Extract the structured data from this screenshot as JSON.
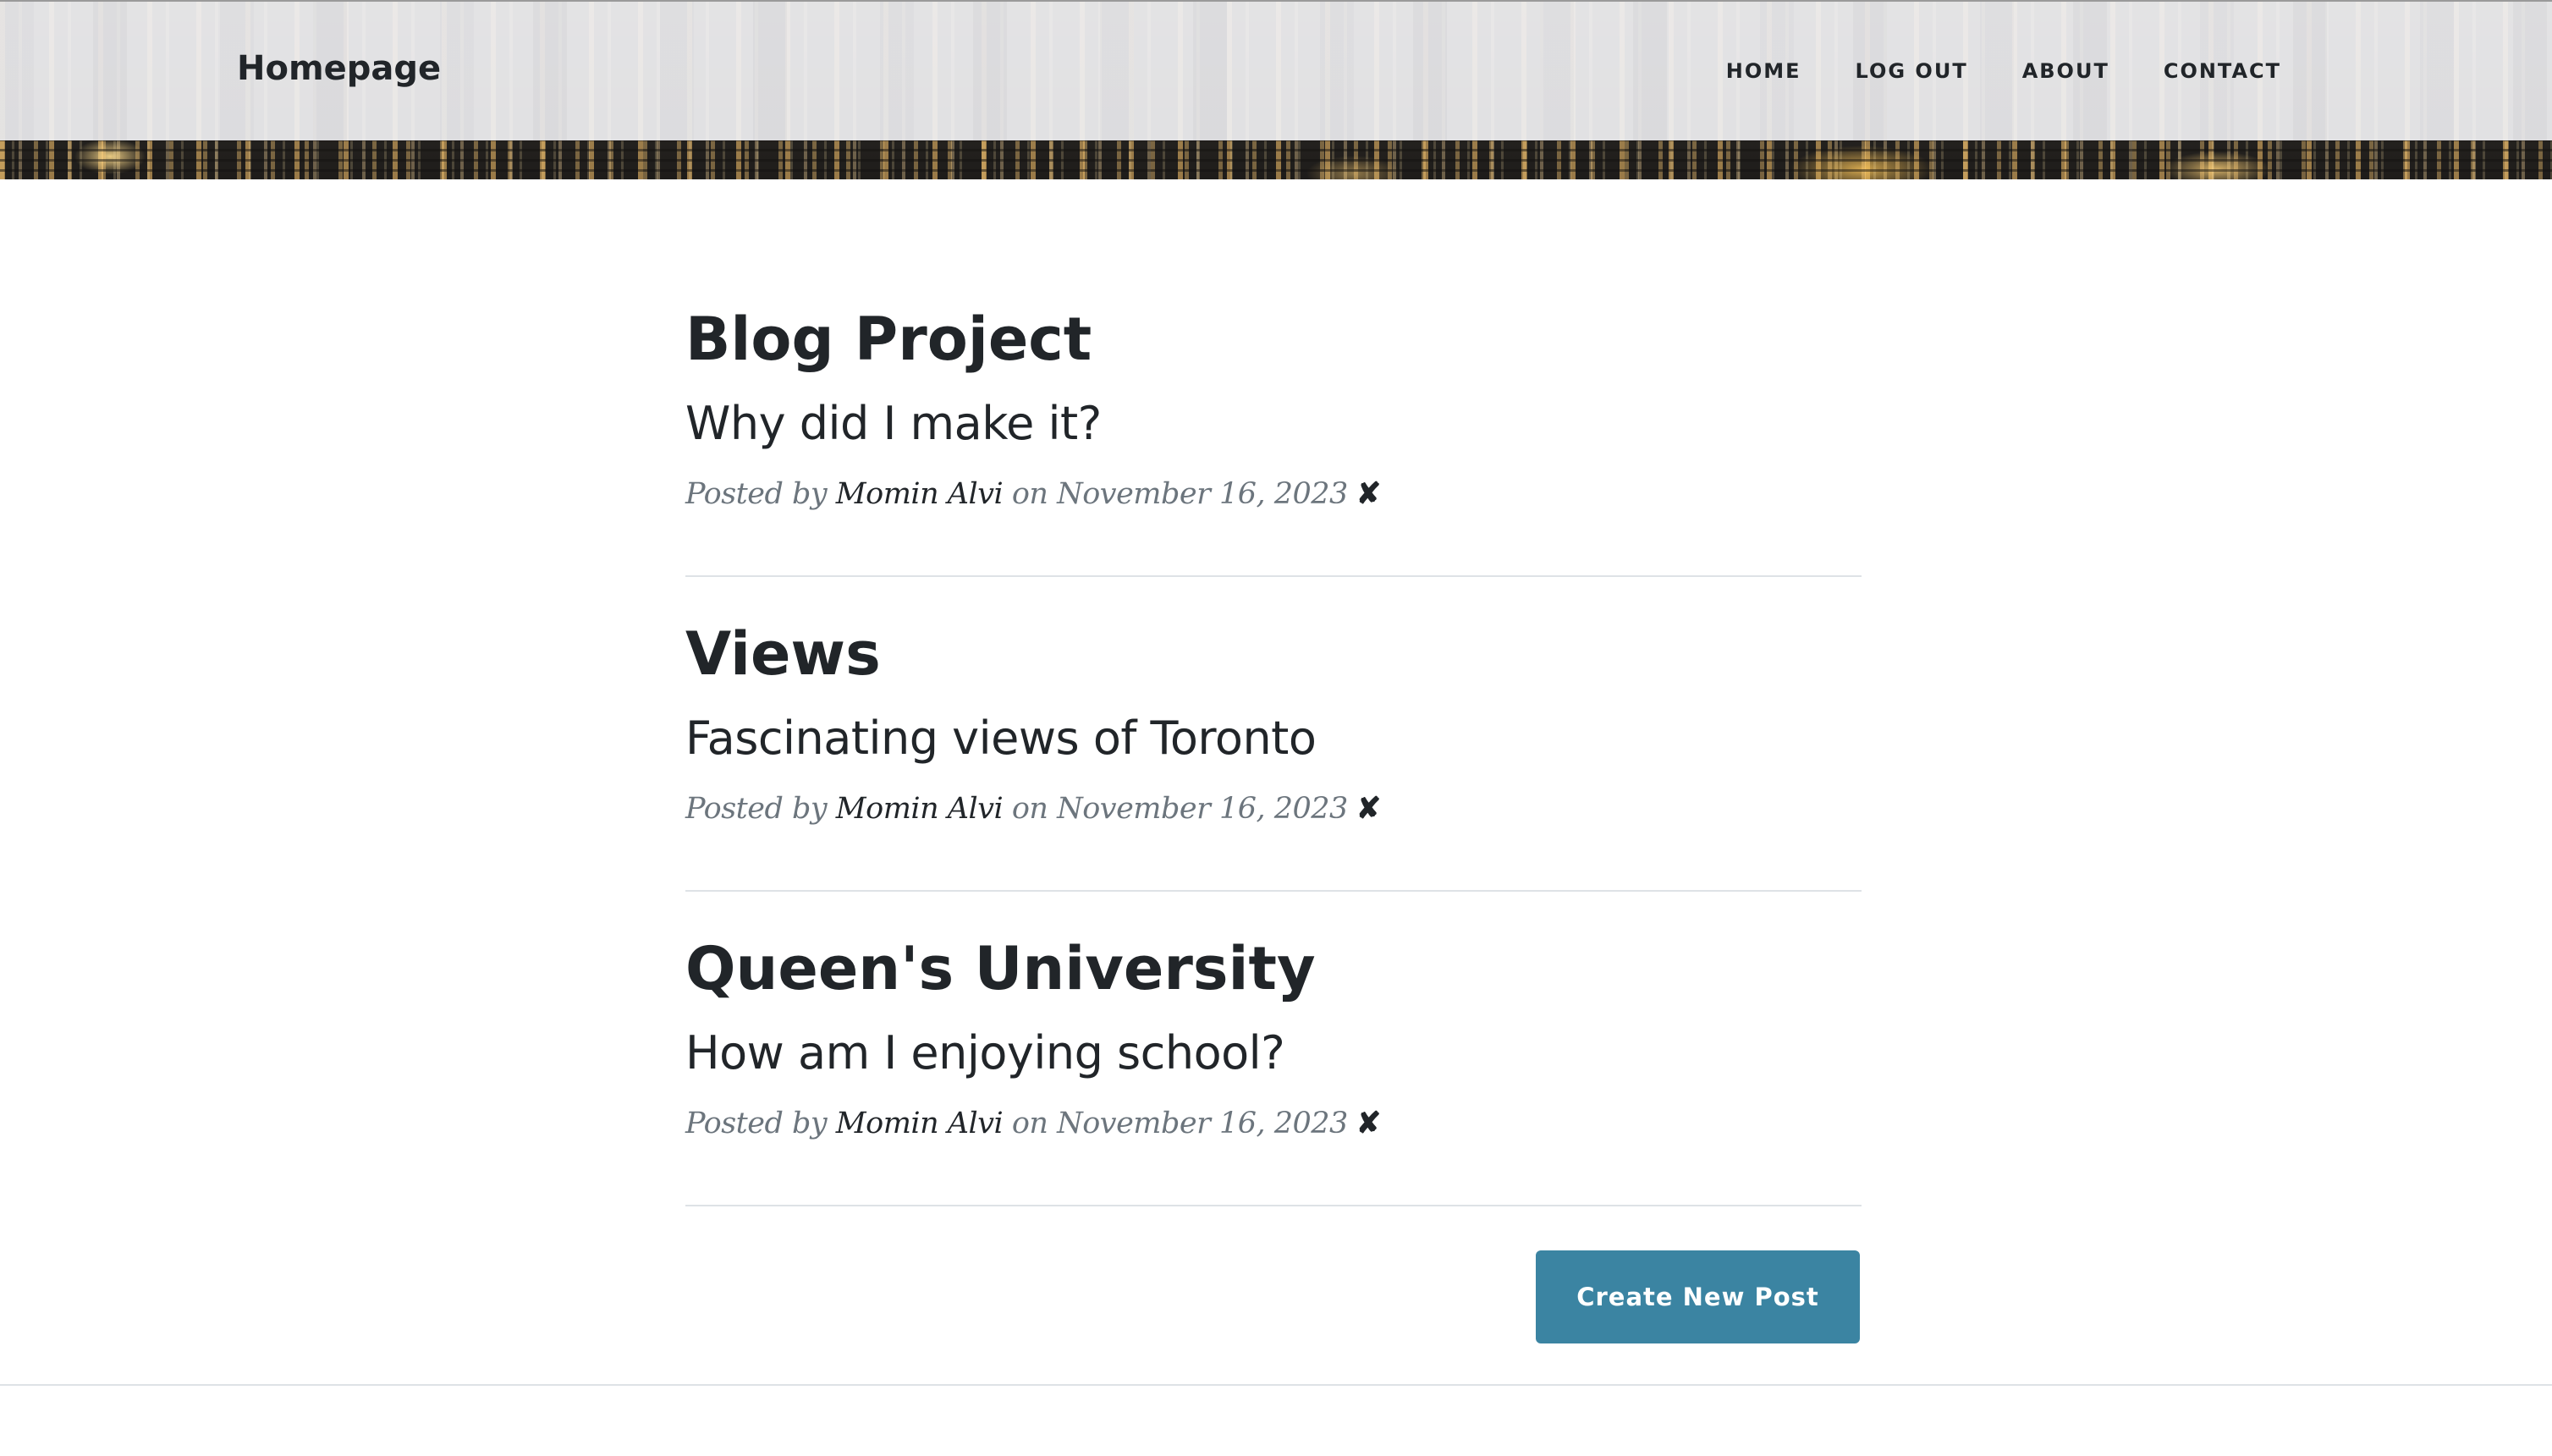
{
  "header": {
    "brand": "Homepage",
    "nav": {
      "home": "HOME",
      "logout": "LOG OUT",
      "about": "ABOUT",
      "contact": "CONTACT"
    }
  },
  "posts": [
    {
      "title": "Blog Project",
      "subtitle": "Why did I make it?",
      "posted_by": "Posted by",
      "author": "Momin Alvi",
      "on": "on",
      "date": "November 16, 2023",
      "delete_icon": "✘"
    },
    {
      "title": "Views",
      "subtitle": "Fascinating views of Toronto",
      "posted_by": "Posted by",
      "author": "Momin Alvi",
      "on": "on",
      "date": "November 16, 2023",
      "delete_icon": "✘"
    },
    {
      "title": "Queen's University",
      "subtitle": "How am I enjoying school?",
      "posted_by": "Posted by",
      "author": "Momin Alvi",
      "on": "on",
      "date": "November 16, 2023",
      "delete_icon": "✘"
    }
  ],
  "actions": {
    "create_label": "Create New Post"
  },
  "colors": {
    "accent": "#3b84a2",
    "text": "#212529",
    "muted": "#6c757d",
    "rule": "#dee2e6"
  }
}
